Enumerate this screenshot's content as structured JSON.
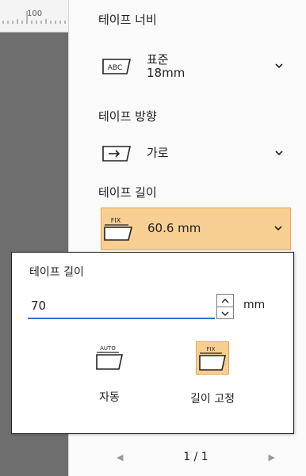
{
  "ruler": {
    "label": "100"
  },
  "tape_width": {
    "label": "테이프 너비",
    "icon": "abc-tape-icon",
    "icon_text": "ABC",
    "value_main": "표준",
    "value_sub": "18mm"
  },
  "tape_direction": {
    "label": "테이프 방향",
    "icon": "horizontal-arrow-icon",
    "value": "가로"
  },
  "tape_length": {
    "label": "테이프 길이",
    "icon": "fix-length-icon",
    "icon_text": "FIX",
    "value": "60.6 mm"
  },
  "popup": {
    "title": "테이프 길이",
    "input_value": "70",
    "unit": "mm",
    "options": [
      {
        "label": "자동",
        "icon_text": "AUTO",
        "selected": false
      },
      {
        "label": "길이 고정",
        "icon_text": "FIX",
        "selected": true
      }
    ]
  },
  "pager": {
    "text": "1 / 1"
  },
  "colors": {
    "accent": "#f7cf93",
    "accent_border": "#e9a64c",
    "focus": "#2b74c7"
  }
}
